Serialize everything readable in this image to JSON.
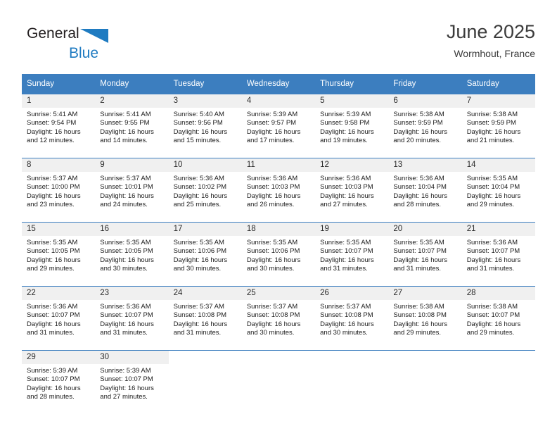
{
  "brand": {
    "name_part1": "General",
    "name_part2": "Blue",
    "triangle_icon": "blue-triangle-logo",
    "accent_color": "#1f7bc1"
  },
  "header": {
    "title": "June 2025",
    "location": "Wormhout, France"
  },
  "theme": {
    "header_blue": "#3c7ebf",
    "daynum_band": "#f0f0f0",
    "text": "#1a1a1a"
  },
  "calendar": {
    "weekday_headers": [
      "Sunday",
      "Monday",
      "Tuesday",
      "Wednesday",
      "Thursday",
      "Friday",
      "Saturday"
    ],
    "labels": {
      "sunrise": "Sunrise:",
      "sunset": "Sunset:",
      "daylight": "Daylight:"
    },
    "weeks": [
      [
        {
          "day": "1",
          "sunrise": "Sunrise: 5:41 AM",
          "sunset": "Sunset: 9:54 PM",
          "daylight_1": "Daylight: 16 hours",
          "daylight_2": "and 12 minutes."
        },
        {
          "day": "2",
          "sunrise": "Sunrise: 5:41 AM",
          "sunset": "Sunset: 9:55 PM",
          "daylight_1": "Daylight: 16 hours",
          "daylight_2": "and 14 minutes."
        },
        {
          "day": "3",
          "sunrise": "Sunrise: 5:40 AM",
          "sunset": "Sunset: 9:56 PM",
          "daylight_1": "Daylight: 16 hours",
          "daylight_2": "and 15 minutes."
        },
        {
          "day": "4",
          "sunrise": "Sunrise: 5:39 AM",
          "sunset": "Sunset: 9:57 PM",
          "daylight_1": "Daylight: 16 hours",
          "daylight_2": "and 17 minutes."
        },
        {
          "day": "5",
          "sunrise": "Sunrise: 5:39 AM",
          "sunset": "Sunset: 9:58 PM",
          "daylight_1": "Daylight: 16 hours",
          "daylight_2": "and 19 minutes."
        },
        {
          "day": "6",
          "sunrise": "Sunrise: 5:38 AM",
          "sunset": "Sunset: 9:59 PM",
          "daylight_1": "Daylight: 16 hours",
          "daylight_2": "and 20 minutes."
        },
        {
          "day": "7",
          "sunrise": "Sunrise: 5:38 AM",
          "sunset": "Sunset: 9:59 PM",
          "daylight_1": "Daylight: 16 hours",
          "daylight_2": "and 21 minutes."
        }
      ],
      [
        {
          "day": "8",
          "sunrise": "Sunrise: 5:37 AM",
          "sunset": "Sunset: 10:00 PM",
          "daylight_1": "Daylight: 16 hours",
          "daylight_2": "and 23 minutes."
        },
        {
          "day": "9",
          "sunrise": "Sunrise: 5:37 AM",
          "sunset": "Sunset: 10:01 PM",
          "daylight_1": "Daylight: 16 hours",
          "daylight_2": "and 24 minutes."
        },
        {
          "day": "10",
          "sunrise": "Sunrise: 5:36 AM",
          "sunset": "Sunset: 10:02 PM",
          "daylight_1": "Daylight: 16 hours",
          "daylight_2": "and 25 minutes."
        },
        {
          "day": "11",
          "sunrise": "Sunrise: 5:36 AM",
          "sunset": "Sunset: 10:03 PM",
          "daylight_1": "Daylight: 16 hours",
          "daylight_2": "and 26 minutes."
        },
        {
          "day": "12",
          "sunrise": "Sunrise: 5:36 AM",
          "sunset": "Sunset: 10:03 PM",
          "daylight_1": "Daylight: 16 hours",
          "daylight_2": "and 27 minutes."
        },
        {
          "day": "13",
          "sunrise": "Sunrise: 5:36 AM",
          "sunset": "Sunset: 10:04 PM",
          "daylight_1": "Daylight: 16 hours",
          "daylight_2": "and 28 minutes."
        },
        {
          "day": "14",
          "sunrise": "Sunrise: 5:35 AM",
          "sunset": "Sunset: 10:04 PM",
          "daylight_1": "Daylight: 16 hours",
          "daylight_2": "and 29 minutes."
        }
      ],
      [
        {
          "day": "15",
          "sunrise": "Sunrise: 5:35 AM",
          "sunset": "Sunset: 10:05 PM",
          "daylight_1": "Daylight: 16 hours",
          "daylight_2": "and 29 minutes."
        },
        {
          "day": "16",
          "sunrise": "Sunrise: 5:35 AM",
          "sunset": "Sunset: 10:05 PM",
          "daylight_1": "Daylight: 16 hours",
          "daylight_2": "and 30 minutes."
        },
        {
          "day": "17",
          "sunrise": "Sunrise: 5:35 AM",
          "sunset": "Sunset: 10:06 PM",
          "daylight_1": "Daylight: 16 hours",
          "daylight_2": "and 30 minutes."
        },
        {
          "day": "18",
          "sunrise": "Sunrise: 5:35 AM",
          "sunset": "Sunset: 10:06 PM",
          "daylight_1": "Daylight: 16 hours",
          "daylight_2": "and 30 minutes."
        },
        {
          "day": "19",
          "sunrise": "Sunrise: 5:35 AM",
          "sunset": "Sunset: 10:07 PM",
          "daylight_1": "Daylight: 16 hours",
          "daylight_2": "and 31 minutes."
        },
        {
          "day": "20",
          "sunrise": "Sunrise: 5:35 AM",
          "sunset": "Sunset: 10:07 PM",
          "daylight_1": "Daylight: 16 hours",
          "daylight_2": "and 31 minutes."
        },
        {
          "day": "21",
          "sunrise": "Sunrise: 5:36 AM",
          "sunset": "Sunset: 10:07 PM",
          "daylight_1": "Daylight: 16 hours",
          "daylight_2": "and 31 minutes."
        }
      ],
      [
        {
          "day": "22",
          "sunrise": "Sunrise: 5:36 AM",
          "sunset": "Sunset: 10:07 PM",
          "daylight_1": "Daylight: 16 hours",
          "daylight_2": "and 31 minutes."
        },
        {
          "day": "23",
          "sunrise": "Sunrise: 5:36 AM",
          "sunset": "Sunset: 10:07 PM",
          "daylight_1": "Daylight: 16 hours",
          "daylight_2": "and 31 minutes."
        },
        {
          "day": "24",
          "sunrise": "Sunrise: 5:37 AM",
          "sunset": "Sunset: 10:08 PM",
          "daylight_1": "Daylight: 16 hours",
          "daylight_2": "and 31 minutes."
        },
        {
          "day": "25",
          "sunrise": "Sunrise: 5:37 AM",
          "sunset": "Sunset: 10:08 PM",
          "daylight_1": "Daylight: 16 hours",
          "daylight_2": "and 30 minutes."
        },
        {
          "day": "26",
          "sunrise": "Sunrise: 5:37 AM",
          "sunset": "Sunset: 10:08 PM",
          "daylight_1": "Daylight: 16 hours",
          "daylight_2": "and 30 minutes."
        },
        {
          "day": "27",
          "sunrise": "Sunrise: 5:38 AM",
          "sunset": "Sunset: 10:08 PM",
          "daylight_1": "Daylight: 16 hours",
          "daylight_2": "and 29 minutes."
        },
        {
          "day": "28",
          "sunrise": "Sunrise: 5:38 AM",
          "sunset": "Sunset: 10:07 PM",
          "daylight_1": "Daylight: 16 hours",
          "daylight_2": "and 29 minutes."
        }
      ],
      [
        {
          "day": "29",
          "sunrise": "Sunrise: 5:39 AM",
          "sunset": "Sunset: 10:07 PM",
          "daylight_1": "Daylight: 16 hours",
          "daylight_2": "and 28 minutes."
        },
        {
          "day": "30",
          "sunrise": "Sunrise: 5:39 AM",
          "sunset": "Sunset: 10:07 PM",
          "daylight_1": "Daylight: 16 hours",
          "daylight_2": "and 27 minutes."
        },
        {
          "day": "",
          "sunrise": "",
          "sunset": "",
          "daylight_1": "",
          "daylight_2": ""
        },
        {
          "day": "",
          "sunrise": "",
          "sunset": "",
          "daylight_1": "",
          "daylight_2": ""
        },
        {
          "day": "",
          "sunrise": "",
          "sunset": "",
          "daylight_1": "",
          "daylight_2": ""
        },
        {
          "day": "",
          "sunrise": "",
          "sunset": "",
          "daylight_1": "",
          "daylight_2": ""
        },
        {
          "day": "",
          "sunrise": "",
          "sunset": "",
          "daylight_1": "",
          "daylight_2": ""
        }
      ]
    ]
  }
}
